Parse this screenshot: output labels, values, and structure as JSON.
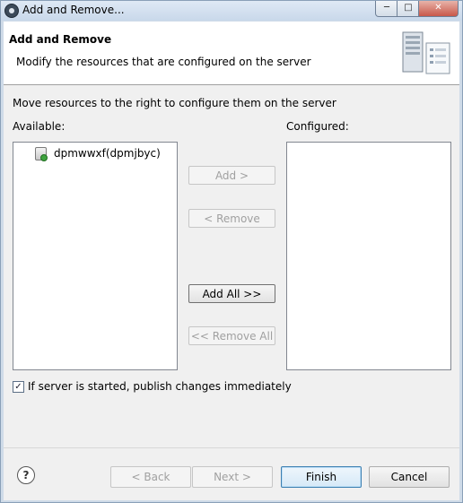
{
  "window": {
    "title": "Add and Remove...",
    "minimize_label": "─",
    "maximize_label": "□",
    "close_label": "✕"
  },
  "banner": {
    "title": "Add and Remove",
    "description": "Modify the resources that are configured on the server",
    "icon": "server-config-icon"
  },
  "main": {
    "instruction": "Move resources to the right to configure them on the server",
    "available_label": "Available:",
    "configured_label": "Configured:",
    "available_items": [
      {
        "label": "dpmwwxf(dpmjbyc)",
        "icon": "server-module-icon"
      }
    ],
    "configured_items": []
  },
  "buttons": {
    "add": "Add >",
    "remove": "< Remove",
    "add_all": "Add All >>",
    "remove_all": "<< Remove All"
  },
  "publish": {
    "checked": true,
    "label": "If server is started, publish changes immediately"
  },
  "footer": {
    "help_label": "?",
    "back": "< Back",
    "next": "Next >",
    "finish": "Finish",
    "cancel": "Cancel"
  }
}
